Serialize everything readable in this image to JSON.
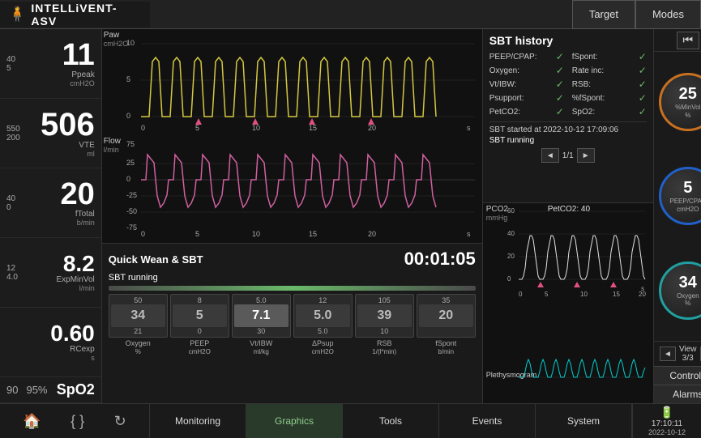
{
  "header": {
    "logo": "INTELLiVENT-ASV",
    "target_label": "Target",
    "modes_label": "Modes"
  },
  "vitals": {
    "ppeak": {
      "high": "40",
      "low": "5",
      "value": "11",
      "label": "Ppeak",
      "unit": "cmH2O"
    },
    "vte": {
      "high": "550",
      "low": "200",
      "value": "506",
      "label": "VTE",
      "unit": "ml"
    },
    "ftotal": {
      "high": "40",
      "low": "0",
      "value": "20",
      "label": "fTotal",
      "unit": "b/min"
    },
    "expminvol": {
      "high": "12",
      "low": "4.0",
      "value": "8.2",
      "label": "ExpMinVol",
      "unit": "l/min"
    },
    "rcexp": {
      "value": "0.60",
      "label": "RCexp",
      "unit": "s"
    },
    "spo2": {
      "low": "90",
      "high": "95%",
      "value": "SpO2"
    }
  },
  "charts": {
    "paw_label": "Paw",
    "paw_unit": "cmH2O",
    "flow_label": "Flow",
    "flow_unit": "l/min"
  },
  "quick_wean": {
    "title": "Quick Wean & SBT",
    "timer": "00:01:05",
    "status": "SBT running",
    "params": [
      {
        "label": "Oxygen\n%",
        "value": "34",
        "top": "50",
        "bottom": "21"
      },
      {
        "label": "PEEP\ncmH2O",
        "value": "5",
        "top": "8",
        "bottom": "0"
      },
      {
        "label": "Vt/IBW\nml/kg",
        "value": "7.1",
        "top": "5.0",
        "bottom": "30"
      },
      {
        "label": "ΔPsup\ncmH2O",
        "value": "5.0",
        "top": "12",
        "bottom": "5.0"
      },
      {
        "label": "RSB\n1/(l*min)",
        "value": "39",
        "top": "105",
        "bottom": "10"
      },
      {
        "label": "fSpont\nb/min",
        "value": "20",
        "top": "35",
        "bottom": ""
      }
    ]
  },
  "sbt_history": {
    "title": "SBT history",
    "items_left": [
      {
        "key": "PEEP/CPAP:",
        "check": true
      },
      {
        "key": "Oxygen:",
        "check": true
      },
      {
        "key": "Vt/IBW:",
        "check": true
      },
      {
        "key": "Psupport:",
        "check": true
      },
      {
        "key": "PetCO2:",
        "check": true
      }
    ],
    "items_right": [
      {
        "key": "fSpont:",
        "check": true
      },
      {
        "key": "Rate inc:",
        "check": true
      },
      {
        "key": "RSB:",
        "check": true
      },
      {
        "key": "%fSpont:",
        "check": true
      },
      {
        "key": "SpO2:",
        "check": true
      }
    ],
    "started": "SBT started at 2022-10-12 17:09:06",
    "running": "SBT running",
    "nav_page": "1/1"
  },
  "pco2_chart": {
    "label": "PCO2",
    "unit": "mmHg",
    "petco2": "PetCO2: 40",
    "plethys": "Plethysmogram"
  },
  "dials": [
    {
      "value": "25",
      "label": "%MinVol\n%",
      "color": "orange"
    },
    {
      "value": "5",
      "label": "PEEP/CPAP\ncmH2O",
      "color": "blue"
    },
    {
      "value": "34",
      "label": "Oxygen\n%",
      "color": "teal"
    }
  ],
  "view": {
    "label": "View\n3/3"
  },
  "sidebar_buttons": {
    "controls": "Controls",
    "alarms": "Alarms"
  },
  "bottom_nav": [
    {
      "label": "Monitoring",
      "active": false
    },
    {
      "label": "Graphics",
      "active": false
    },
    {
      "label": "Tools",
      "active": false
    },
    {
      "label": "Events",
      "active": false
    },
    {
      "label": "System",
      "active": false
    }
  ],
  "battery": {
    "time": "17:10:11",
    "date": "2022-10-12"
  }
}
